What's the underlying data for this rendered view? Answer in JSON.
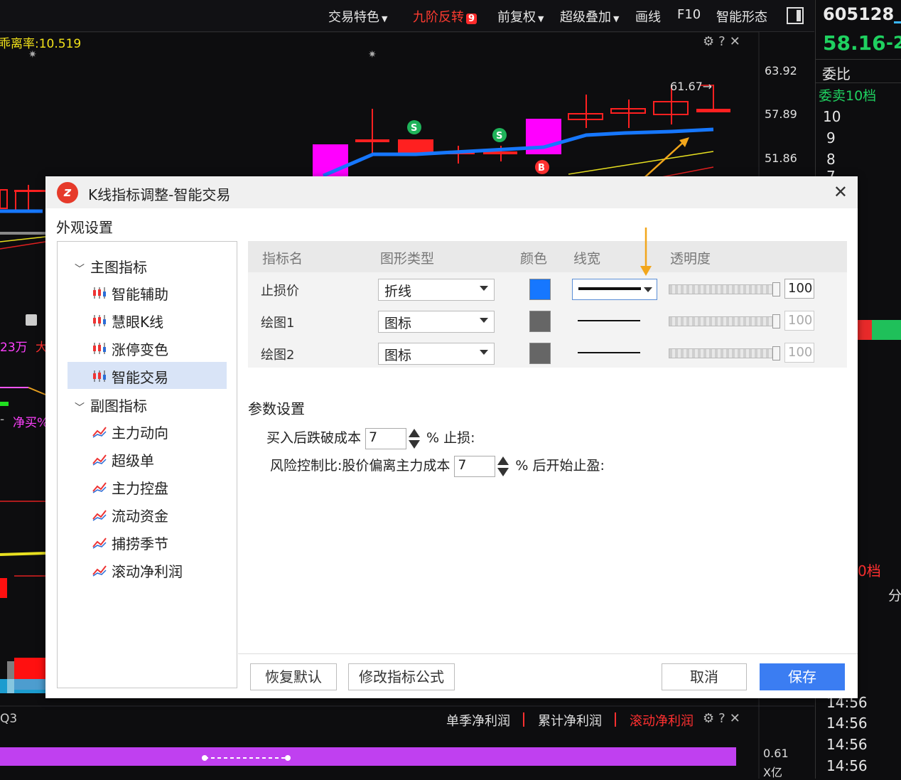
{
  "toolbar": {
    "items": [
      "交易特色",
      "九阶反转",
      "前复权",
      "超级叠加",
      "画线",
      "F10",
      "智能形态"
    ],
    "badge": "9"
  },
  "indicator_text": "乖离率:10.519",
  "price_axis": [
    "63.92",
    "57.89",
    "51.86"
  ],
  "price_marker": "61.67→",
  "stock": {
    "code": "605128",
    "price": "58.16",
    "change_fragment": "-2",
    "label_weibi": "委比",
    "label_weimai": "委卖10档",
    "levels": [
      "10",
      "9",
      "8",
      "7"
    ],
    "side_label": "0档",
    "side_fen": "分",
    "times": [
      "14:56",
      "14:56",
      "14:56",
      "14:56"
    ]
  },
  "left_fragments": {
    "amount": "23万",
    "big": "大",
    "netbuy": "净买%",
    "dash": "-",
    "q3": "Q3"
  },
  "bottom_bar": {
    "tabs": [
      "单季净利润",
      "累计净利润",
      "滚动净利润"
    ],
    "value": "0.61",
    "unit": "X亿"
  },
  "dialog": {
    "title": "K线指标调整-智能交易",
    "appearance_label": "外观设置",
    "tree": {
      "main_group": "主图指标",
      "main_items": [
        "智能辅助",
        "慧眼K线",
        "涨停变色",
        "智能交易"
      ],
      "sub_group": "副图指标",
      "sub_items": [
        "主力动向",
        "超级单",
        "主力控盘",
        "流动资金",
        "捕捞季节",
        "滚动净利润"
      ]
    },
    "table": {
      "headers": [
        "指标名",
        "图形类型",
        "颜色",
        "线宽",
        "透明度"
      ],
      "rows": [
        {
          "name": "止损价",
          "type": "折线",
          "color": "#1677ff",
          "opacity": "100"
        },
        {
          "name": "绘图1",
          "type": "图标",
          "color": "#666666",
          "opacity": "100"
        },
        {
          "name": "绘图2",
          "type": "图标",
          "color": "#666666",
          "opacity": "100"
        }
      ]
    },
    "params_label": "参数设置",
    "params": {
      "row1_prefix": "买入后跌破成本",
      "row1_value": "7",
      "row1_suffix": "% 止损:",
      "row2_prefix": "风险控制比:股价偏离主力成本",
      "row2_value": "7",
      "row2_suffix": "% 后开始止盈:"
    },
    "buttons": {
      "restore": "恢复默认",
      "edit_formula": "修改指标公式",
      "cancel": "取消",
      "save": "保存"
    }
  }
}
